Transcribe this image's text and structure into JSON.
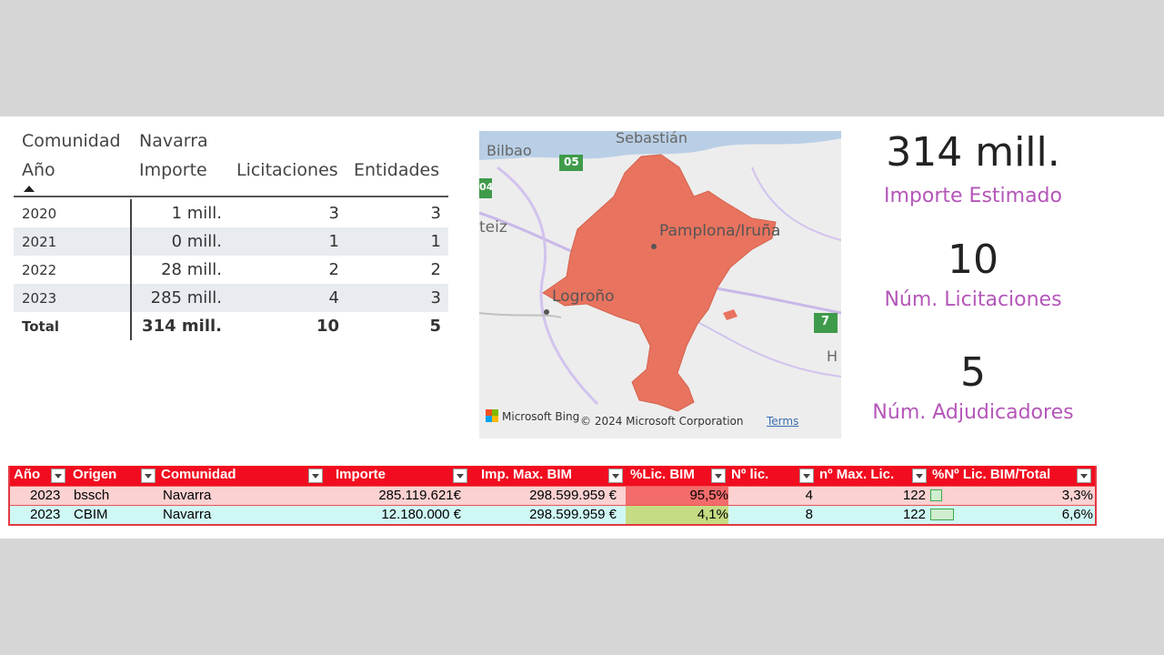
{
  "matrix": {
    "filter_field": "Comunidad",
    "filter_value": "Navarra",
    "columns": {
      "year": "Año",
      "importe": "Importe",
      "licitaciones": "Licitaciones",
      "entidades": "Entidades"
    },
    "rows": [
      {
        "year": "2020",
        "importe": "1 mill.",
        "licitaciones": "3",
        "entidades": "3"
      },
      {
        "year": "2021",
        "importe": "0 mill.",
        "licitaciones": "1",
        "entidades": "1"
      },
      {
        "year": "2022",
        "importe": "28 mill.",
        "licitaciones": "2",
        "entidades": "2"
      },
      {
        "year": "2023",
        "importe": "285 mill.",
        "licitaciones": "4",
        "entidades": "3"
      }
    ],
    "total": {
      "label": "Total",
      "importe": "314 mill.",
      "licitaciones": "10",
      "entidades": "5"
    }
  },
  "map": {
    "labels": {
      "sebastian": "Sebastián",
      "bilbao": "Bilbao",
      "road_05": "05",
      "road_04": "04",
      "teiz": "teiz",
      "pamplona": "Pamplona/Iruña",
      "logrono": "Logroño",
      "road_7": "7",
      "h": "H"
    },
    "region_color": "#e8735e",
    "attribution": "Microsoft Bing",
    "copyright": "© 2024 Microsoft Corporation",
    "terms": "Terms"
  },
  "kpis": [
    {
      "value": "314 mill.",
      "label": "Importe Estimado"
    },
    {
      "value": "10",
      "label": "Núm. Licitaciones"
    },
    {
      "value": "5",
      "label": "Núm. Adjudicadores"
    }
  ],
  "sheet": {
    "headers": {
      "anio": "Año",
      "origen": "Origen",
      "comunidad": "Comunidad",
      "importe": "Importe",
      "imp_max_bim": "Imp. Max. BIM",
      "pct_lic_bim": "%Lic. BIM",
      "n_lic": "Nº lic.",
      "n_max_lic": "nº Max. Lic.",
      "pct_n_lic_bim_total": "%Nº Lic. BIM/Total"
    },
    "rows": [
      {
        "anio": "2023",
        "origen": "bssch",
        "comunidad": "Navarra",
        "importe": "285.119.621€",
        "imp_max_bim": "298.599.959 €",
        "pct_lic_bim": "95,5%",
        "n_lic": "4",
        "n_max_lic": "122",
        "pct_n_lic_bim_total": "3,3%",
        "bar_fraction": 0.033
      },
      {
        "anio": "2023",
        "origen": "CBIM",
        "comunidad": "Navarra",
        "importe": "12.180.000 €",
        "imp_max_bim": "298.599.959 €",
        "pct_lic_bim": "4,1%",
        "n_lic": "8",
        "n_max_lic": "122",
        "pct_n_lic_bim_total": "6,6%",
        "bar_fraction": 0.066
      }
    ],
    "colors": {
      "header": "#f10d1f",
      "row1": "#fbd1d1",
      "row2": "#cff8f5",
      "pct_high": "#f46b6b",
      "pct_low": "#c5dc84"
    }
  }
}
